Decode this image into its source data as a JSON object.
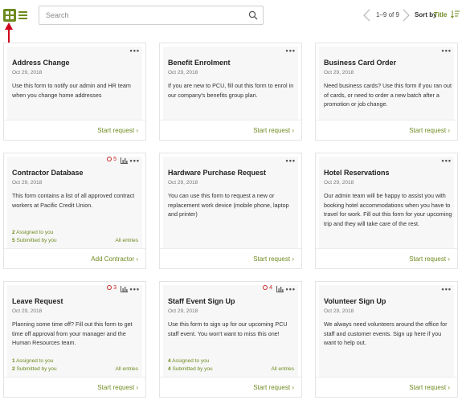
{
  "toolbar": {
    "search_placeholder": "Search",
    "pager_count": "1–9 of 9",
    "sort_label": "Sort by",
    "sort_value": "Title"
  },
  "colors": {
    "accent": "#6e8a1f",
    "alert": "#c62828",
    "annotation_arrow": "#d0021b"
  },
  "cards": [
    {
      "title": "Address Change",
      "date": "Oct 29, 2018",
      "description": "Use this form to notify our admin and HR team when you change home addresses",
      "action": "Start request"
    },
    {
      "title": "Benefit Enrolment",
      "date": "Oct 29, 2018",
      "description": "If you are new to PCU, fill out this form to enrol in our company's benefits group plan.",
      "action": "Start request"
    },
    {
      "title": "Business Card Order",
      "date": "Oct 29, 2018",
      "description": "Need business cards? Use this form if you ran out of cards, or need to order a new batch after a promotion or job change.",
      "action": "Start request"
    },
    {
      "title": "Contractor Database",
      "date": "Oct 29, 2018",
      "description": "This form contains a list of all approved contract workers at Pacific Credit Union.",
      "badge": "5",
      "assigned": "2",
      "assigned_label": "Assigned to you",
      "submitted": "5",
      "submitted_label": "Submitted by you",
      "all_entries": "All entries",
      "action": "Add Contractor"
    },
    {
      "title": "Hardware Purchase Request",
      "date": "Oct 29, 2018",
      "description": "You can use this form to request a new or replacement work device (mobile phone, laptop and printer)",
      "action": "Start request"
    },
    {
      "title": "Hotel Reservations",
      "date": "Oct 29, 2018",
      "description": "Our admin team will be happy to assist you with booking hotel accommodations when you have to travel for work. Fill out this form for your upcoming trip and they will take care of the rest.",
      "action": "Start request"
    },
    {
      "title": "Leave Request",
      "date": "Oct 29, 2018",
      "description": "Planning some time off? Fill out this form to get time off approval from your manager and the Human Resources team.",
      "badge": "3",
      "assigned": "1",
      "assigned_label": "Assigned to you",
      "submitted": "2",
      "submitted_label": "Submitted by you",
      "all_entries": "All entries",
      "action": "Start request"
    },
    {
      "title": "Staff Event Sign Up",
      "date": "Oct 29, 2018",
      "description": "Use this form to sign up for our upcoming PCU staff event. You won't want to miss this one!",
      "badge": "4",
      "assigned": "4",
      "assigned_label": "Assigned to you",
      "submitted": "4",
      "submitted_label": "Submitted by you",
      "all_entries": "All entries",
      "action": "Start request"
    },
    {
      "title": "Volunteer Sign Up",
      "date": "Oct 29, 2018",
      "description": "We always need volunteers around the office for staff and customer events. Sign up here if you want to help out.",
      "action": "Start request"
    }
  ]
}
